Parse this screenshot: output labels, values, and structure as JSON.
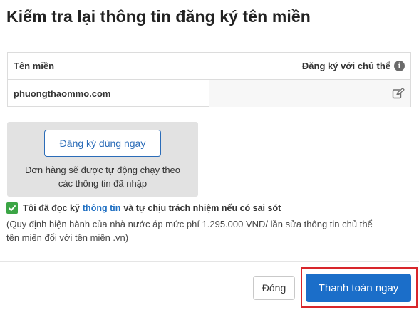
{
  "dialog": {
    "title": "Kiểm tra lại thông tin đăng ký tên miền"
  },
  "table": {
    "headers": [
      "Tên miền",
      "Đăng ký với chủ thể"
    ],
    "rows": [
      {
        "domain": "phuongthaommo.com",
        "owner": ""
      }
    ],
    "info_icon_glyph": "i"
  },
  "quick_register": {
    "button_label": "Đăng ký dùng ngay",
    "note_line1": "Đơn hàng sẽ được tự động chạy theo",
    "note_line2": "các thông tin đã nhập"
  },
  "agreement": {
    "prefix": "Tôi đã đọc kỹ",
    "link_text": "thông tin",
    "suffix": "và tự chịu trách nhiệm nếu có sai sót",
    "checked": true,
    "note_line1": "(Quy định hiện hành của nhà nước áp mức phí 1.295.000 VNĐ/ lần sửa thông tin chủ thể",
    "note_line2": "tên miền đổi với tên miền .vn)"
  },
  "footer": {
    "close_label": "Đóng",
    "pay_label": "Thanh toán ngay"
  },
  "colors": {
    "primary": "#1b6ec9",
    "link": "#1f6fc2",
    "highlight": "#d8262b",
    "check": "#3ba545"
  }
}
